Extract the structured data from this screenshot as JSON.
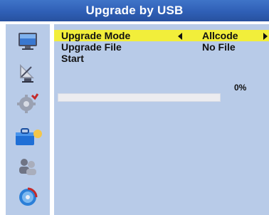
{
  "header": {
    "title": "Upgrade by USB"
  },
  "sidebar": {
    "items": [
      {
        "icon": "tv-monitor-icon"
      },
      {
        "icon": "satellite-dish-icon"
      },
      {
        "icon": "gear-settings-icon"
      },
      {
        "icon": "toolbox-icon"
      },
      {
        "icon": "users-icon"
      },
      {
        "icon": "media-disc-icon"
      }
    ]
  },
  "menu": {
    "items": [
      {
        "label": "Upgrade Mode",
        "value": "Allcode",
        "selected": true
      },
      {
        "label": "Upgrade File",
        "value": "No File",
        "selected": false
      },
      {
        "label": "Start",
        "value": "",
        "selected": false
      }
    ]
  },
  "progress": {
    "label": "0%",
    "fraction": 0
  },
  "colors": {
    "title_bar": "#2f5fb6",
    "panel": "#b8cbe8",
    "highlight": "#f2ee3a",
    "text": "#111111"
  }
}
